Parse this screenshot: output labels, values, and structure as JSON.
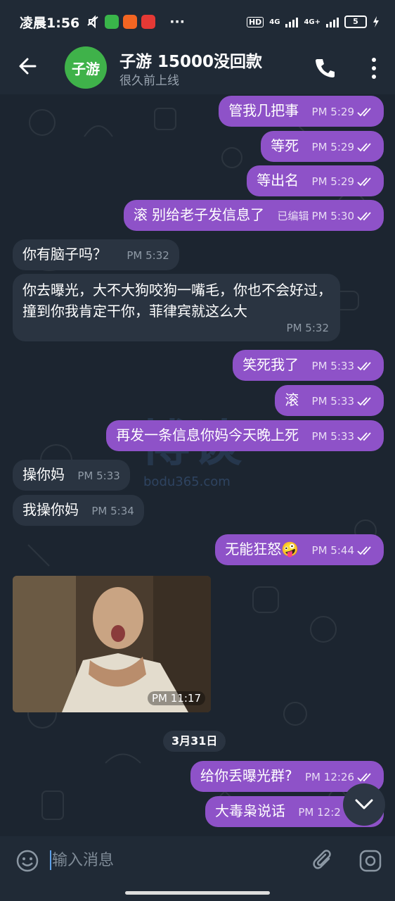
{
  "status_bar": {
    "time": "凌晨1:56",
    "more": "···",
    "hd": "HD",
    "net1": "4G",
    "net2": "4G+",
    "battery": "5"
  },
  "header": {
    "avatar_text": "子游",
    "title": "子游 15000没回款",
    "subtitle": "很久前上线",
    "avatar_color": "#3fb24a"
  },
  "messages": [
    {
      "dir": "out",
      "text": "管我几把事",
      "time": "PM 5:29",
      "ticks": "double"
    },
    {
      "dir": "out",
      "text": "等死",
      "time": "PM 5:29",
      "ticks": "double"
    },
    {
      "dir": "out",
      "text": "等出名",
      "time": "PM 5:29",
      "ticks": "double"
    },
    {
      "dir": "out",
      "text": "滚 别给老子发信息了",
      "edited": "已编辑",
      "time": "PM 5:30",
      "ticks": "double"
    },
    {
      "dir": "in",
      "text": "你有脑子吗？",
      "time": "PM 5:32"
    },
    {
      "dir": "in",
      "text": "你去曝光，大不大狗咬狗一嘴毛，你也不会好过，撞到你我肯定干你，菲律宾就这么大",
      "time": "PM 5:32"
    },
    {
      "dir": "out",
      "text": "笑死我了",
      "time": "PM 5:33",
      "ticks": "double"
    },
    {
      "dir": "out",
      "text": "滚",
      "time": "PM 5:33",
      "ticks": "double"
    },
    {
      "dir": "out",
      "text": "再发一条信息你妈今天晚上死",
      "time": "PM 5:33",
      "ticks": "double"
    },
    {
      "dir": "in",
      "text": "操你妈",
      "time": "PM 5:33"
    },
    {
      "dir": "in",
      "text": "我操你妈",
      "time": "PM 5:34"
    },
    {
      "dir": "out",
      "text": "无能狂怒🤪",
      "time": "PM 5:44",
      "ticks": "double"
    },
    {
      "dir": "in",
      "kind": "photo",
      "time": "PM 11:17"
    },
    {
      "dir": "out",
      "text": "给你丢曝光群?",
      "time": "PM 12:26",
      "ticks": "double"
    },
    {
      "dir": "out",
      "text": "大毒枭说话",
      "time": "PM 12:2"
    }
  ],
  "date_separator": "3月31日",
  "watermark": {
    "main": "博谈",
    "sub": "bodu365.com"
  },
  "composer": {
    "placeholder": "输入消息"
  },
  "colors": {
    "outgoing": "#8e52c8",
    "incoming": "#2a3441",
    "background": "#1c2530"
  },
  "icons": [
    "back-arrow-icon",
    "phone-icon",
    "more-vert-icon",
    "emoji-icon",
    "attach-icon",
    "camera-icon",
    "chevron-down-icon"
  ]
}
